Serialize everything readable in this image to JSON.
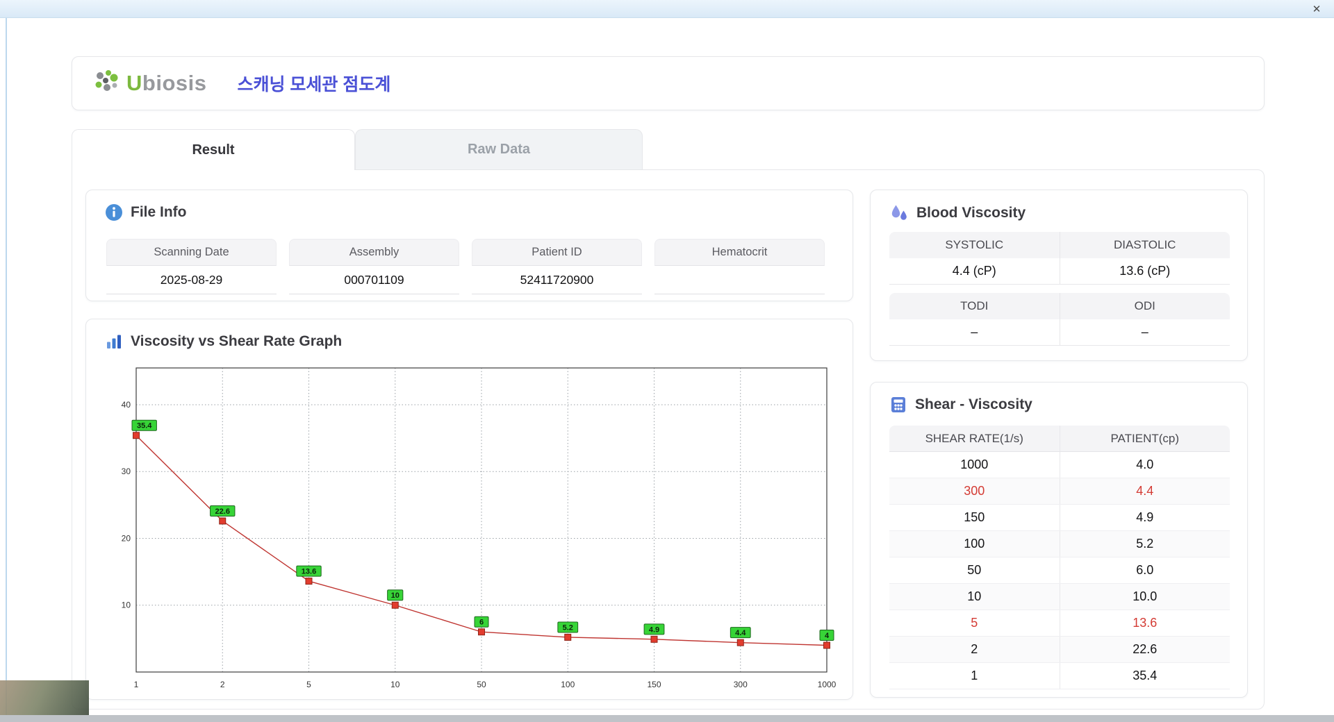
{
  "titlebar": {
    "close": "✕"
  },
  "icons": {
    "logo": "dot-cluster-leaf",
    "file_info": "blue-circle-i",
    "blood_viscosity": "water-drops",
    "graph": "bar-chart",
    "shear": "calculator-grid",
    "close": "✕"
  },
  "header": {
    "brand_u": "U",
    "brand_rest": "biosis",
    "title": "스캐닝 모세관 점도계"
  },
  "tabs": {
    "result": "Result",
    "raw_data": "Raw Data"
  },
  "file_info": {
    "title": "File Info",
    "fields": [
      {
        "label": "Scanning Date",
        "value": "2025-08-29"
      },
      {
        "label": "Assembly",
        "value": "000701109"
      },
      {
        "label": "Patient ID",
        "value": "52411720900"
      },
      {
        "label": "Hematocrit",
        "value": ""
      }
    ]
  },
  "blood_viscosity": {
    "title": "Blood Viscosity",
    "systolic_label": "SYSTOLIC",
    "systolic_value": "4.4 (cP)",
    "diastolic_label": "DIASTOLIC",
    "diastolic_value": "13.6 (cP)",
    "todi_label": "TODI",
    "todi_value": "–",
    "odi_label": "ODI",
    "odi_value": "–"
  },
  "graph": {
    "title": "Viscosity vs Shear Rate Graph"
  },
  "chart_data": {
    "type": "line",
    "title": "Viscosity vs Shear Rate Graph",
    "x_categories": [
      "1",
      "2",
      "5",
      "10",
      "50",
      "100",
      "150",
      "300",
      "1000"
    ],
    "values": [
      35.4,
      22.6,
      13.6,
      10,
      6,
      5.2,
      4.9,
      4.4,
      4
    ],
    "point_labels": [
      "35.4",
      "22.6",
      "13.6",
      "10",
      "6",
      "5.2",
      "4.9",
      "4.4",
      "4"
    ],
    "yticks": [
      10,
      20,
      30,
      40
    ],
    "ylim": [
      0,
      45.5
    ],
    "xlabel": "",
    "ylabel": "",
    "grid": "dotted",
    "legend": "none",
    "line_color": "#bf3430",
    "marker_color": "#e23c2e",
    "point_label_bg": "#37d437"
  },
  "shear_table": {
    "title": "Shear - Viscosity",
    "columns": [
      "SHEAR RATE(1/s)",
      "PATIENT(cp)"
    ],
    "rows": [
      {
        "rate": "1000",
        "patient": "4.0",
        "highlight": false
      },
      {
        "rate": "300",
        "patient": "4.4",
        "highlight": true
      },
      {
        "rate": "150",
        "patient": "4.9",
        "highlight": false
      },
      {
        "rate": "100",
        "patient": "5.2",
        "highlight": false
      },
      {
        "rate": "50",
        "patient": "6.0",
        "highlight": false
      },
      {
        "rate": "10",
        "patient": "10.0",
        "highlight": false
      },
      {
        "rate": "5",
        "patient": "13.6",
        "highlight": true
      },
      {
        "rate": "2",
        "patient": "22.6",
        "highlight": false
      },
      {
        "rate": "1",
        "patient": "35.4",
        "highlight": false
      }
    ]
  }
}
